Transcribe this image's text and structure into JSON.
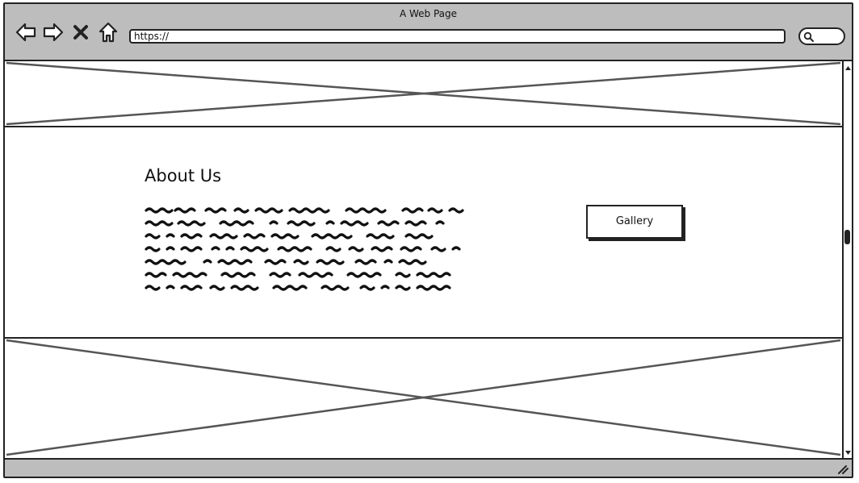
{
  "window": {
    "title": "A Web Page"
  },
  "toolbar": {
    "icons": [
      "back-arrow-icon",
      "forward-arrow-icon",
      "close-x-icon",
      "home-icon"
    ]
  },
  "address_bar": {
    "value": "https://"
  },
  "search": {
    "icon": "magnifier-icon"
  },
  "about": {
    "title": "About Us",
    "body_lines": 7
  },
  "gallery_button": {
    "label": "Gallery"
  },
  "colors": {
    "chrome": "#bdbdbd",
    "stroke": "#222222",
    "placeholder_cross": "#555555"
  }
}
